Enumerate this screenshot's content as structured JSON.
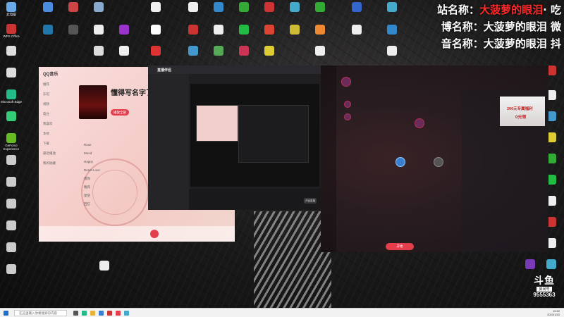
{
  "overlay": {
    "line1_a": "站名称：",
    "line1_b": "大菠萝的眼泪",
    "line1_c": "· 吃",
    "line2": "博名称：大菠萝的眼泪 微",
    "line3": "音名称：大菠萝的眼泪 抖"
  },
  "desktop_icons": {
    "c1": [
      {
        "label": "此电脑",
        "icon": "pc-icon",
        "color": "#6aa9e8"
      },
      {
        "label": "WPS Office",
        "icon": "wps-icon",
        "color": "#c33"
      },
      {
        "label": "",
        "icon": "file-icon",
        "color": "#ddd"
      },
      {
        "label": "",
        "icon": "file-icon",
        "color": "#ddd"
      },
      {
        "label": "Microsoft Edge",
        "icon": "edge-icon",
        "color": "#2b8"
      },
      {
        "label": "",
        "icon": "app-icon",
        "color": "#3c7"
      },
      {
        "label": "GeForce Experience",
        "icon": "nvidia-icon",
        "color": "#6b2"
      },
      {
        "label": "",
        "icon": "file-icon",
        "color": "#ccc"
      },
      {
        "label": "",
        "icon": "file-icon",
        "color": "#ccc"
      },
      {
        "label": "",
        "icon": "file-icon",
        "color": "#ccc"
      },
      {
        "label": "",
        "icon": "file-icon",
        "color": "#ccc"
      },
      {
        "label": "",
        "icon": "file-icon",
        "color": "#ccc"
      },
      {
        "label": "",
        "icon": "file-icon",
        "color": "#ccc"
      }
    ]
  },
  "qq": {
    "logo": "QQ音乐",
    "nav": [
      "推荐",
      "乐馆",
      "视频",
      "电台",
      "我喜欢",
      "本地",
      "下载",
      "最近播放",
      "我的收藏"
    ],
    "title": "懂得写名字了",
    "play": "播放全部",
    "rows": [
      "Rose",
      "Mood",
      "Happy",
      "Reset Love",
      "想你",
      "晚风",
      "星空",
      "回忆"
    ]
  },
  "obs": {
    "title": "直播伴侣",
    "start": "开始直播"
  },
  "game": {
    "banner_line1": "200元专属福利",
    "banner_line2": "0元领",
    "start_button": "开始"
  },
  "taskbar": {
    "search_placeholder": "在这里输入你要搜索的内容",
    "time": "15:52",
    "date": "2023/1/20"
  },
  "douyu": {
    "logo": "斗鱼",
    "room_label": "房间号",
    "room_number": "9555363"
  }
}
